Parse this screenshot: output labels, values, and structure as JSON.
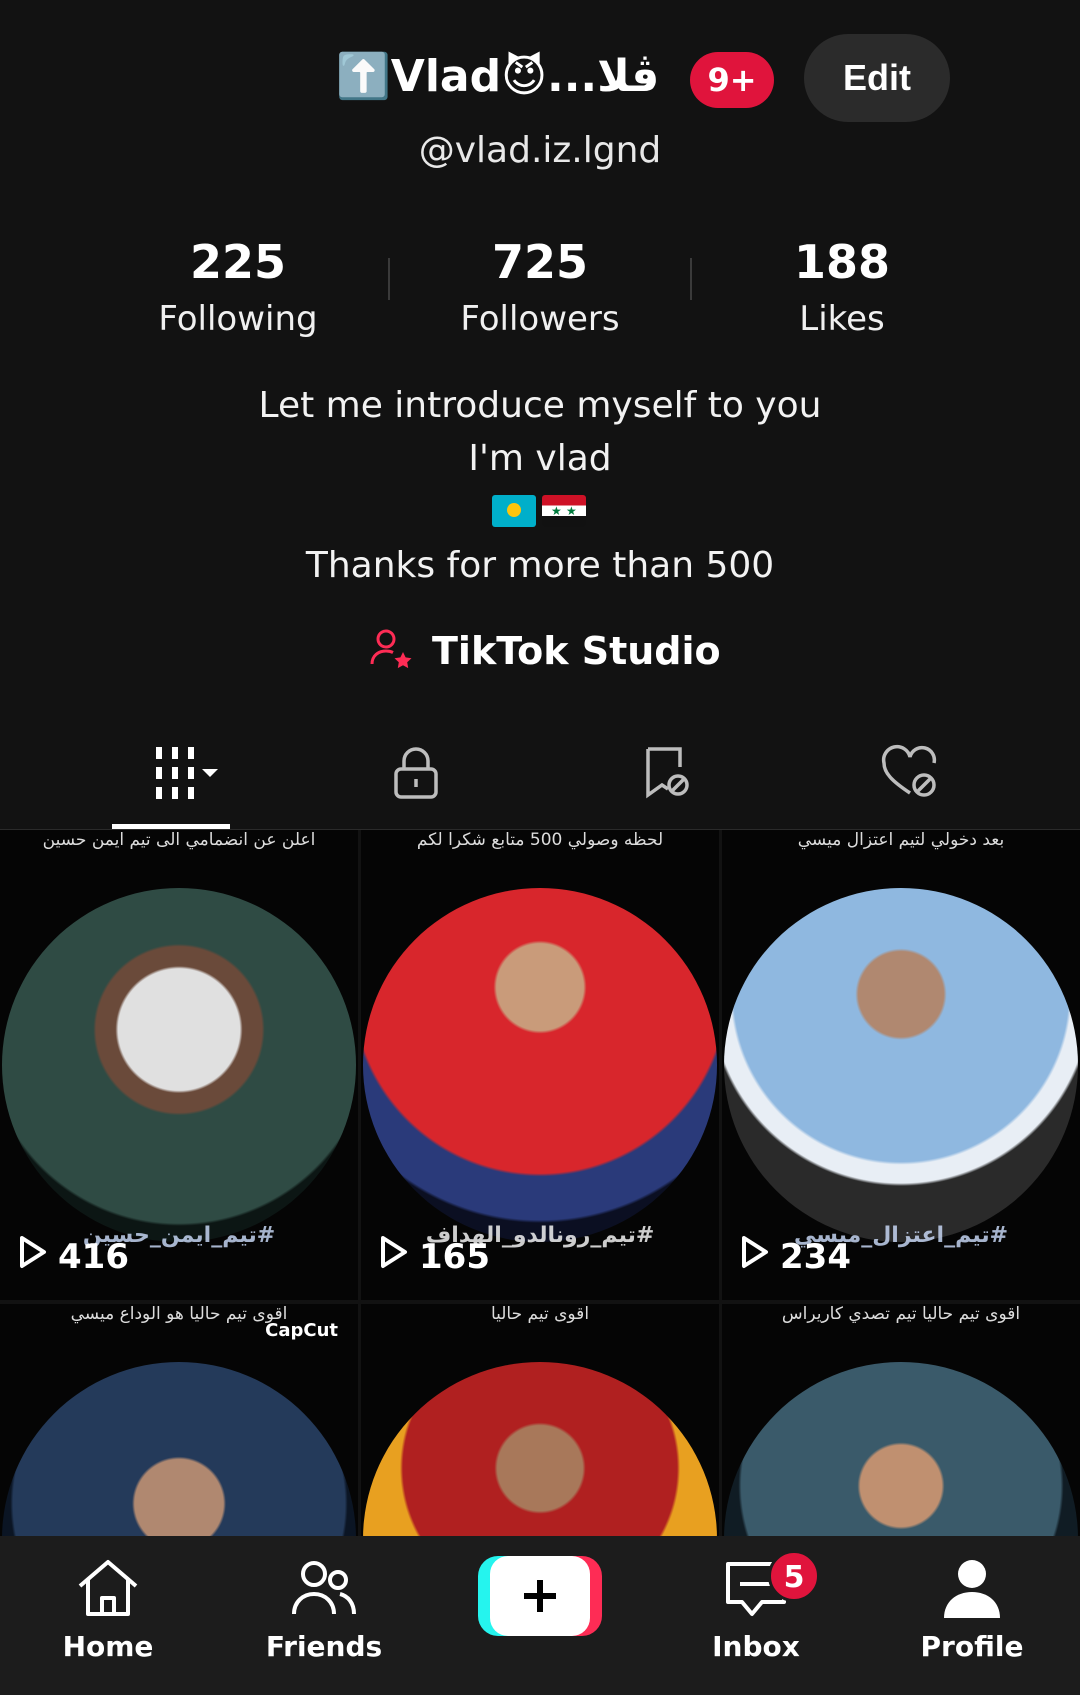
{
  "profile": {
    "display_name": "⬆️Vlad😈...ڤلا",
    "notifications_badge": "9+",
    "edit_label": "Edit",
    "username": "@vlad.iz.lgnd"
  },
  "stats": [
    {
      "value": "225",
      "label": "Following"
    },
    {
      "value": "725",
      "label": "Followers"
    },
    {
      "value": "188",
      "label": "Likes"
    }
  ],
  "bio": {
    "line1": "Let me introduce myself to you",
    "line2": "I'm vlad",
    "line4": "Thanks for more than 500"
  },
  "studio": {
    "label": "TikTok Studio",
    "icon": "creator-star-icon",
    "accent": "#fe2c55"
  },
  "tabs": [
    {
      "icon": "videos-grid-icon",
      "active": true
    },
    {
      "icon": "lock-icon",
      "active": false
    },
    {
      "icon": "favorites-bookmark-icon",
      "active": false
    },
    {
      "icon": "liked-heart-icon",
      "active": false
    }
  ],
  "videos": [
    {
      "caption": "اعلن عن انضمامي الى تيم ايمن حسين",
      "overlay": "#تيم_ايمن_حسين",
      "views": "416"
    },
    {
      "caption": "لحظه وصولي 500 متابع شكرا لكم",
      "overlay": "#تيم_رونالدو_الهداف",
      "views": "165"
    },
    {
      "caption": "بعد دخولي لتيم اعتزال ميسي",
      "overlay": "#تيم_اعتزال_ميسي",
      "views": "234"
    },
    {
      "caption": "اقوى تيم حاليا هو الوداع ميسي",
      "overlay": "",
      "views": "",
      "badge": "CapCut"
    },
    {
      "caption": "اقوى تيم حاليا",
      "overlay": "",
      "views": ""
    },
    {
      "caption": "اقوى تيم حاليا تيم تصدي كاريراس",
      "overlay": "",
      "views": ""
    }
  ],
  "nav": {
    "home": "Home",
    "friends": "Friends",
    "inbox": "Inbox",
    "inbox_badge": "5",
    "profile": "Profile"
  },
  "colors": {
    "background": "#121212",
    "badge": "#e0143c",
    "create_cyan": "#25f4ee",
    "create_pink": "#fe2c55"
  }
}
